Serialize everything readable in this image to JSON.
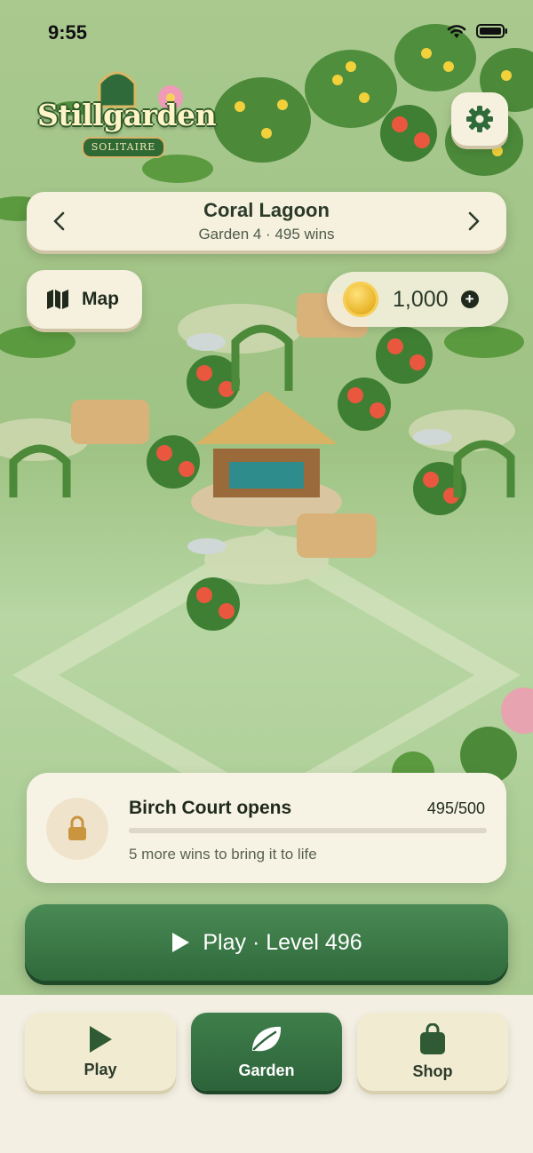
{
  "status_bar": {
    "time": "9:55"
  },
  "logo": {
    "title": "Stillgarden",
    "subtitle": "SOLITAIRE"
  },
  "garden_header": {
    "name": "Coral Lagoon",
    "details": "Garden 4 · 495 wins"
  },
  "map_button": {
    "label": "Map"
  },
  "coins": {
    "amount": "1,000"
  },
  "unlock_card": {
    "title": "Birch Court opens",
    "progress_text": "495/500",
    "progress_fraction": 0.99,
    "hint": "5 more wins to bring it to life"
  },
  "play_button": {
    "label": "Play · Level 496"
  },
  "tabs": [
    {
      "label": "Play",
      "icon": "play-icon",
      "active": false
    },
    {
      "label": "Garden",
      "icon": "leaf-icon",
      "active": true
    },
    {
      "label": "Shop",
      "icon": "bag-icon",
      "active": false
    }
  ],
  "colors": {
    "accent_green": "#2f6a3b",
    "panel_cream": "#f6f1df",
    "scene_green": "#a9c98f"
  }
}
